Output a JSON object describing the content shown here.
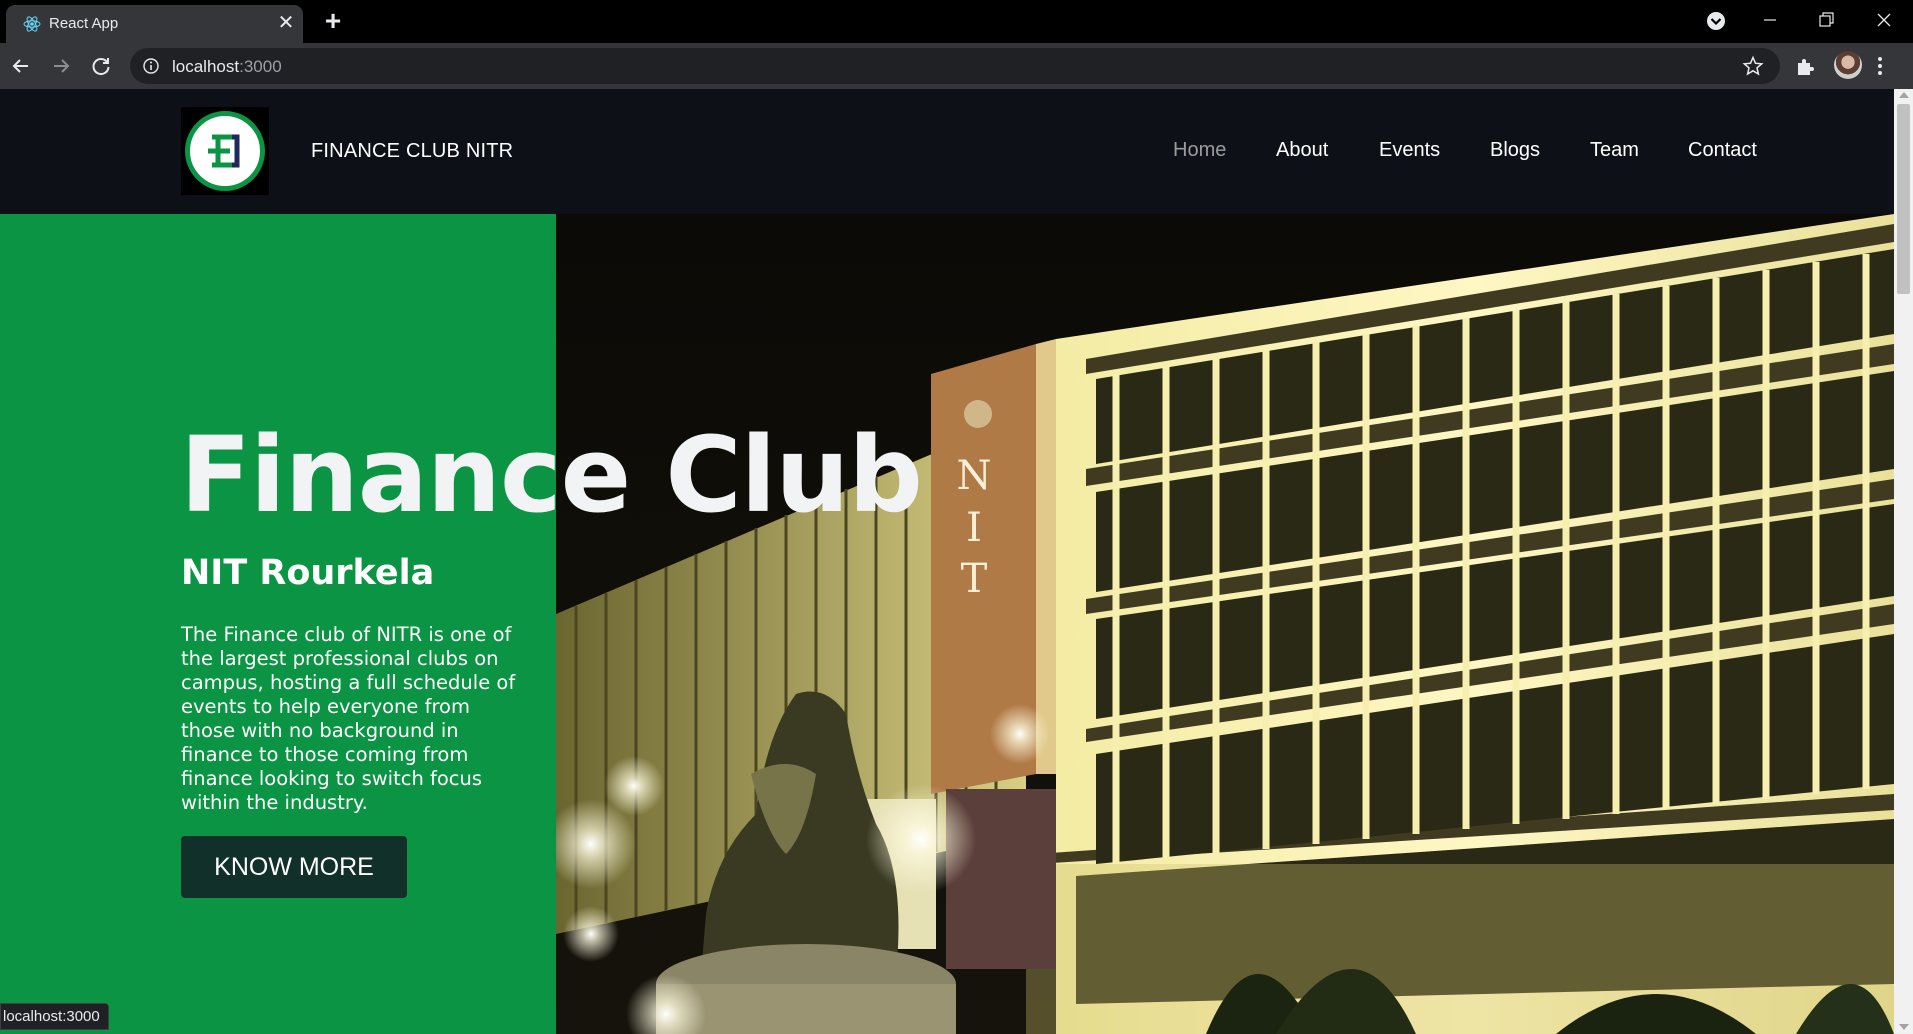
{
  "browser": {
    "tab_title": "React App",
    "url_host": "localhost",
    "url_port": ":3000",
    "status_text": "localhost:3000"
  },
  "site": {
    "brand": "FINANCE CLUB NITR",
    "nav": [
      {
        "label": "Home",
        "active": true
      },
      {
        "label": "About",
        "active": false
      },
      {
        "label": "Events",
        "active": false
      },
      {
        "label": "Blogs",
        "active": false
      },
      {
        "label": "Team",
        "active": false
      },
      {
        "label": "Contact",
        "active": false
      }
    ]
  },
  "hero": {
    "title": "Finance Club",
    "subtitle": "NIT Rourkela",
    "description": "The Finance club of NITR is one of the largest professional clubs on campus, hosting a full schedule of events to help everyone from those with no background in finance to those coming from finance looking to switch focus within the industry.",
    "cta_label": "KNOW MORE",
    "building_sign": "NIT"
  },
  "colors": {
    "brand_green": "#0b9444",
    "page_bg": "#0d1117",
    "cta_bg": "#12302a"
  }
}
